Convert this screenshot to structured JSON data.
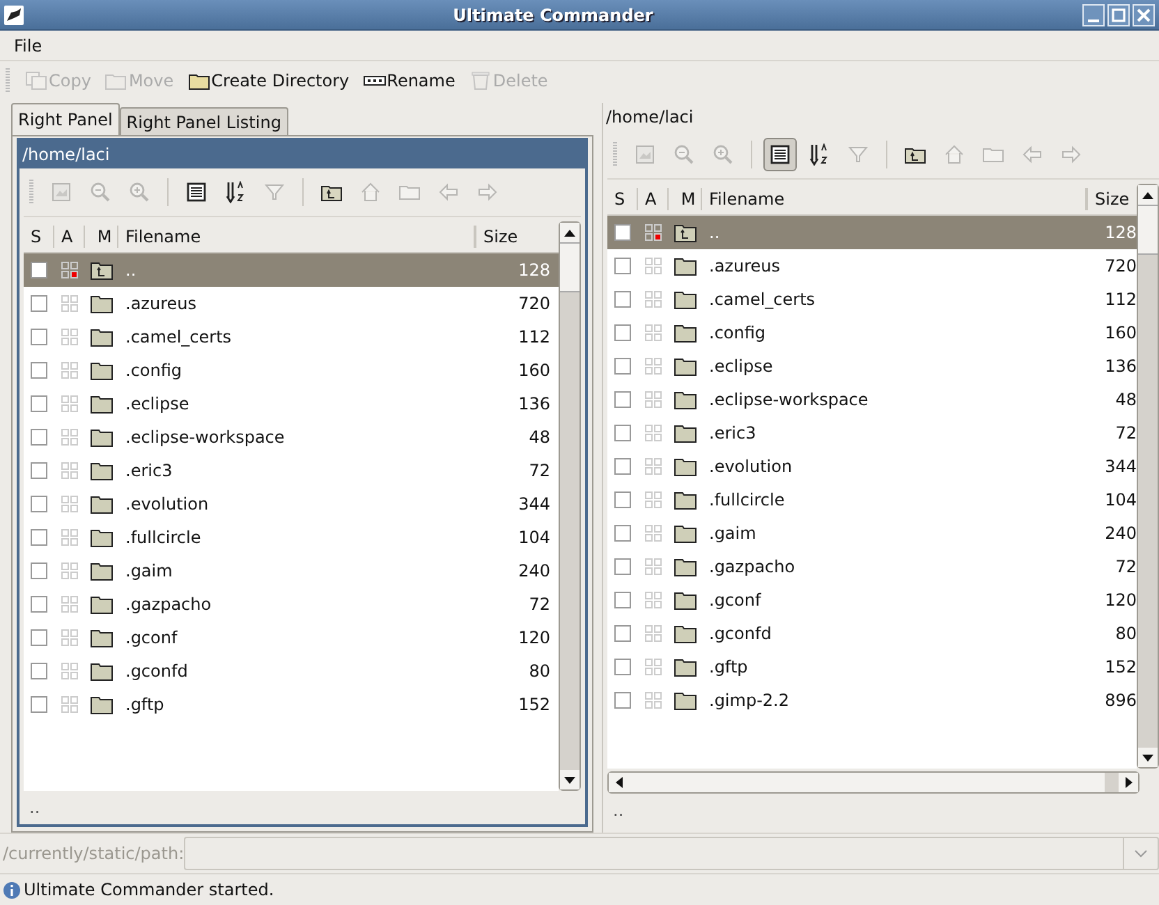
{
  "window": {
    "title": "Ultimate Commander"
  },
  "menu": [
    "File"
  ],
  "toolbar": [
    {
      "label": "Copy",
      "kind": "copy",
      "disabled": true
    },
    {
      "label": "Move",
      "kind": "move",
      "disabled": true
    },
    {
      "label": "Create Directory",
      "kind": "mkdir",
      "disabled": false
    },
    {
      "label": "Rename",
      "kind": "rename",
      "disabled": false
    },
    {
      "label": "Delete",
      "kind": "delete",
      "disabled": true
    }
  ],
  "tabs": [
    {
      "label": "Right Panel",
      "selected": true
    },
    {
      "label": "Right Panel Listing",
      "selected": false
    }
  ],
  "panels": [
    {
      "active": true,
      "path": "/home/laci",
      "tools": [
        {
          "kind": "view",
          "disabled": true,
          "pressed": false
        },
        {
          "kind": "zoom-out",
          "disabled": true,
          "pressed": false
        },
        {
          "kind": "zoom-in",
          "disabled": true,
          "pressed": false
        },
        {
          "kind": "list",
          "disabled": false,
          "pressed": false
        },
        {
          "kind": "sort",
          "disabled": false,
          "pressed": false
        },
        {
          "kind": "filter",
          "disabled": true,
          "pressed": false
        },
        {
          "kind": "parent",
          "disabled": false,
          "pressed": false
        },
        {
          "kind": "home",
          "disabled": true,
          "pressed": false
        },
        {
          "kind": "folder",
          "disabled": true,
          "pressed": false
        },
        {
          "kind": "back",
          "disabled": true,
          "pressed": false
        },
        {
          "kind": "forward",
          "disabled": true,
          "pressed": false
        }
      ],
      "columns": [
        "S",
        "A",
        "M",
        "Filename",
        "Size"
      ],
      "rows": [
        {
          "name": "..",
          "size": "128",
          "kind": "parent",
          "selected": true
        },
        {
          "name": ".azureus",
          "size": "720",
          "kind": "folder",
          "selected": false
        },
        {
          "name": ".camel_certs",
          "size": "112",
          "kind": "folder",
          "selected": false
        },
        {
          "name": ".config",
          "size": "160",
          "kind": "folder",
          "selected": false
        },
        {
          "name": ".eclipse",
          "size": "136",
          "kind": "folder",
          "selected": false
        },
        {
          "name": ".eclipse-workspace",
          "size": "48",
          "kind": "folder",
          "selected": false
        },
        {
          "name": ".eric3",
          "size": "72",
          "kind": "folder",
          "selected": false
        },
        {
          "name": ".evolution",
          "size": "344",
          "kind": "folder",
          "selected": false
        },
        {
          "name": ".fullcircle",
          "size": "104",
          "kind": "folder",
          "selected": false
        },
        {
          "name": ".gaim",
          "size": "240",
          "kind": "folder",
          "selected": false
        },
        {
          "name": ".gazpacho",
          "size": "72",
          "kind": "folder",
          "selected": false
        },
        {
          "name": ".gconf",
          "size": "120",
          "kind": "folder",
          "selected": false
        },
        {
          "name": ".gconfd",
          "size": "80",
          "kind": "folder",
          "selected": false
        },
        {
          "name": ".gftp",
          "size": "152",
          "kind": "folder",
          "selected": false
        }
      ],
      "footer": ".."
    },
    {
      "active": false,
      "path": "/home/laci",
      "tools": [
        {
          "kind": "view",
          "disabled": true,
          "pressed": false
        },
        {
          "kind": "zoom-out",
          "disabled": true,
          "pressed": false
        },
        {
          "kind": "zoom-in",
          "disabled": true,
          "pressed": false
        },
        {
          "kind": "list",
          "disabled": false,
          "pressed": true
        },
        {
          "kind": "sort",
          "disabled": false,
          "pressed": false
        },
        {
          "kind": "filter",
          "disabled": true,
          "pressed": false
        },
        {
          "kind": "parent",
          "disabled": false,
          "pressed": false
        },
        {
          "kind": "home",
          "disabled": true,
          "pressed": false
        },
        {
          "kind": "folder",
          "disabled": true,
          "pressed": false
        },
        {
          "kind": "back",
          "disabled": true,
          "pressed": false
        },
        {
          "kind": "forward",
          "disabled": true,
          "pressed": false
        }
      ],
      "columns": [
        "S",
        "A",
        "M",
        "Filename",
        "Size"
      ],
      "rows": [
        {
          "name": "..",
          "size": "128",
          "kind": "parent",
          "selected": true
        },
        {
          "name": ".azureus",
          "size": "720",
          "kind": "folder",
          "selected": false
        },
        {
          "name": ".camel_certs",
          "size": "112",
          "kind": "folder",
          "selected": false
        },
        {
          "name": ".config",
          "size": "160",
          "kind": "folder",
          "selected": false
        },
        {
          "name": ".eclipse",
          "size": "136",
          "kind": "folder",
          "selected": false
        },
        {
          "name": ".eclipse-workspace",
          "size": "48",
          "kind": "folder",
          "selected": false
        },
        {
          "name": ".eric3",
          "size": "72",
          "kind": "folder",
          "selected": false
        },
        {
          "name": ".evolution",
          "size": "344",
          "kind": "folder",
          "selected": false
        },
        {
          "name": ".fullcircle",
          "size": "104",
          "kind": "folder",
          "selected": false
        },
        {
          "name": ".gaim",
          "size": "240",
          "kind": "folder",
          "selected": false
        },
        {
          "name": ".gazpacho",
          "size": "72",
          "kind": "folder",
          "selected": false
        },
        {
          "name": ".gconf",
          "size": "120",
          "kind": "folder",
          "selected": false
        },
        {
          "name": ".gconfd",
          "size": "80",
          "kind": "folder",
          "selected": false
        },
        {
          "name": ".gftp",
          "size": "152",
          "kind": "folder",
          "selected": false
        },
        {
          "name": ".gimp-2.2",
          "size": "896",
          "kind": "folder",
          "selected": false
        }
      ],
      "footer": ".."
    }
  ],
  "path_field": {
    "label": "/currently/static/path:"
  },
  "status": "Ultimate Commander started."
}
